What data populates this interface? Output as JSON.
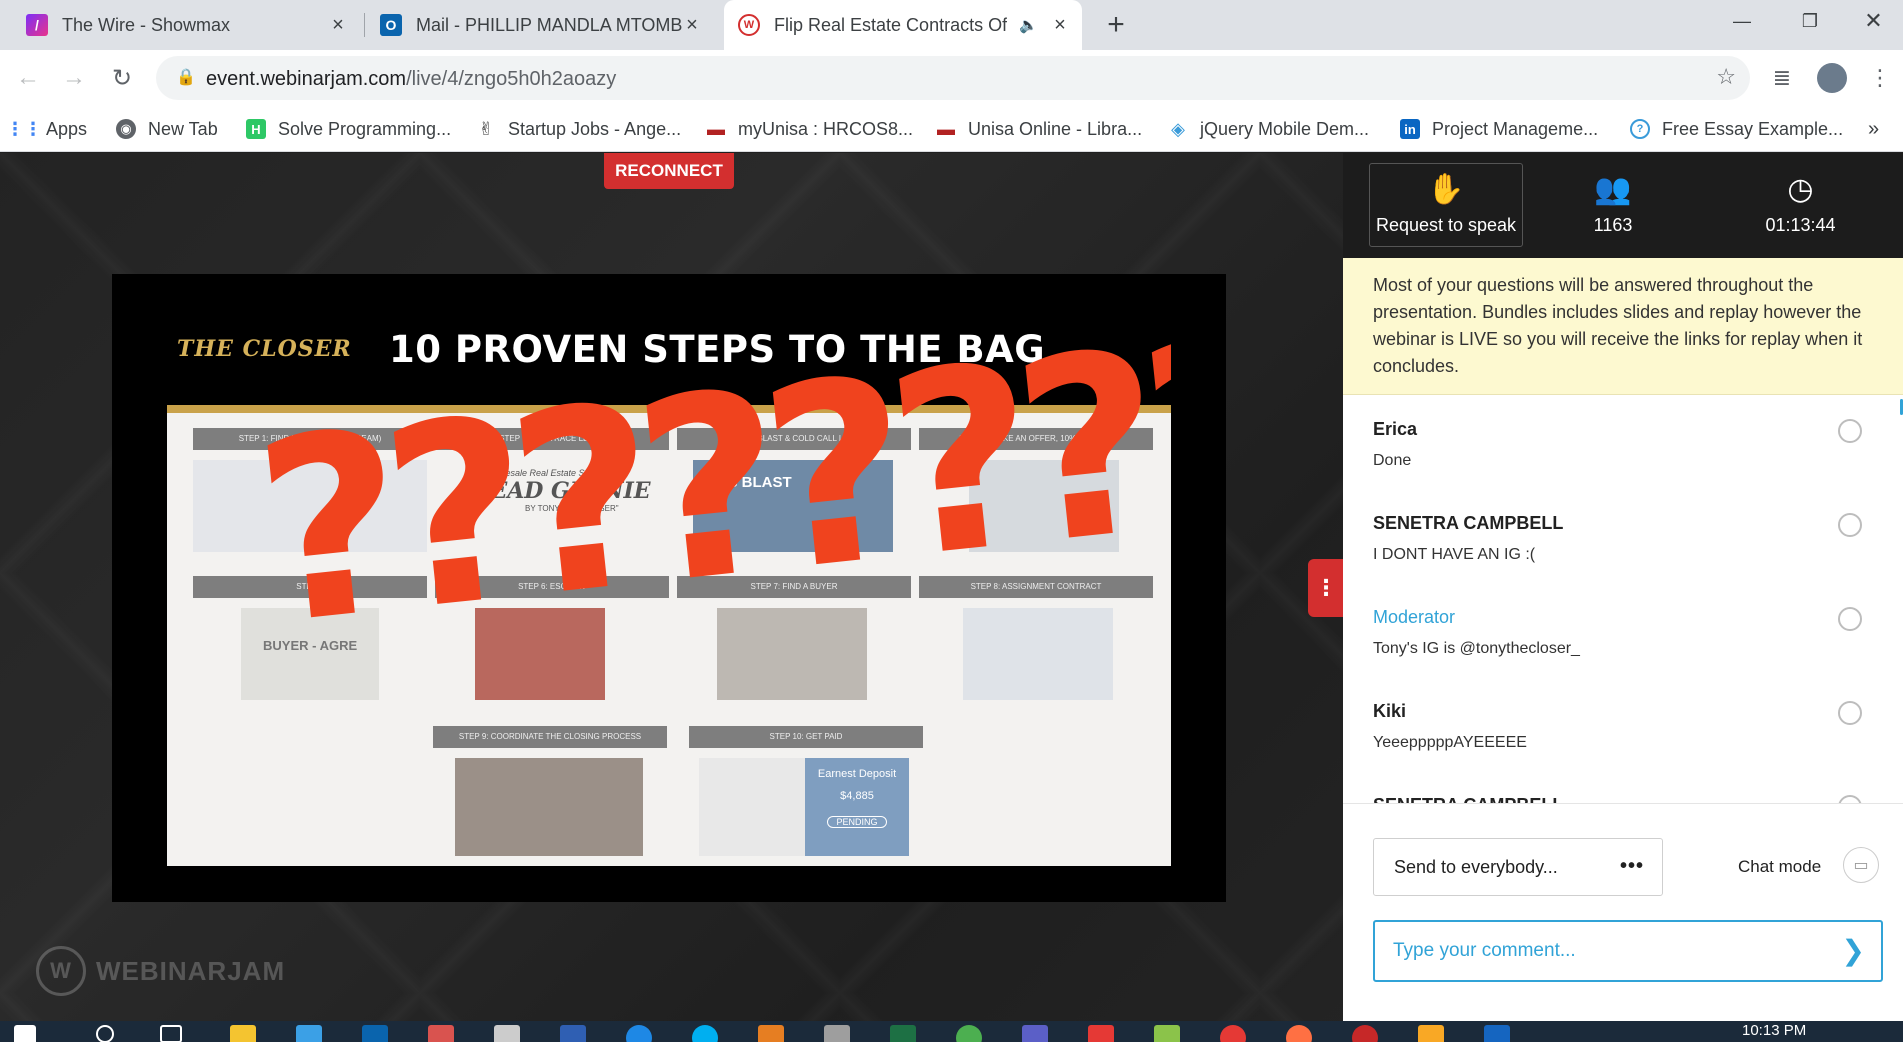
{
  "browser": {
    "tabs": [
      {
        "title": "The Wire - Showmax",
        "icon": "showmax-icon",
        "active": false
      },
      {
        "title": "Mail - PHILLIP MANDLA MTOMB",
        "icon": "outlook-icon",
        "active": false
      },
      {
        "title": "Flip Real Estate Contracts Of",
        "icon": "webinarjam-icon",
        "active": true
      }
    ],
    "new_tab": "+",
    "url_host": "event.webinarjam.com",
    "url_path": "/live/4/zngo5h0h2aoazy",
    "bookmarks": [
      {
        "label": "Apps",
        "icon": "apps-grid-icon",
        "color": "#4285f4"
      },
      {
        "label": "New Tab",
        "icon": "globe-icon",
        "color": "#5f6368"
      },
      {
        "label": "Solve Programming...",
        "icon": "hackerrank-icon",
        "color": "#2ec866"
      },
      {
        "label": "Startup Jobs - Ange...",
        "icon": "angellist-icon",
        "color": "#333333"
      },
      {
        "label": "myUnisa : HRCOS8...",
        "icon": "unisa-icon",
        "color": "#b22222"
      },
      {
        "label": "Unisa Online - Libra...",
        "icon": "unisa-icon",
        "color": "#b22222"
      },
      {
        "label": "jQuery Mobile Dem...",
        "icon": "jquery-icon",
        "color": "#3a9bd9"
      },
      {
        "label": "Project Manageme...",
        "icon": "linkedin-icon",
        "color": "#0a66c2"
      },
      {
        "label": "Free Essay Example...",
        "icon": "essay-icon",
        "color": "#3a9bd9"
      }
    ],
    "bookmarks_more": "»"
  },
  "stage": {
    "reconnect_label": "RECONNECT",
    "slide": {
      "logo": "THE CLOSER",
      "title": "10 PROVEN STEPS TO THE BAG",
      "question_marks": "????????",
      "steps": [
        "STEP 1: FIND LEADS (PROPSTREAM)",
        "STEP 2: SKIPTRACE LEADS",
        "STEP 3: (BLAST & COLD CALL LEADS",
        "STEP 4: MAKE AN OFFER, 10% PER DAY",
        "STEP 5",
        "STEP 6: ESCROW",
        "STEP 7: FIND A BUYER",
        "STEP 8: ASSIGNMENT CONTRACT",
        "STEP 9: COORDINATE THE CLOSING PROCESS",
        "STEP 10: GET PAID"
      ],
      "thumb_texts": {
        "lead_geenie_tag": "Wholesale Real Estate Services!",
        "lead_geenie": "LEAD GEENIE",
        "lead_geenie_by": "BY TONY \"THE CLOSER\"",
        "sms_blast": "SMS BLAST",
        "buyer_agreement": "BUYER - AGRE",
        "earnest_deposit": "Earnest Deposit",
        "deposit_amount": "$4,885",
        "pending": "PENDING"
      }
    },
    "watermark": "WEBINARJAM"
  },
  "sidebar": {
    "request_to_speak": "Request to speak",
    "attendee_count": "1163",
    "elapsed_time": "01:13:44",
    "notice": "Most of your questions will be answered throughout the presentation. Bundles includes slides and replay however the webinar is LIVE so you will receive the links for replay when it concludes.",
    "messages": [
      {
        "author": "Erica",
        "text": "Done",
        "moderator": false
      },
      {
        "author": "SENETRA CAMPBELL",
        "text": "I DONT HAVE AN IG :(",
        "moderator": false
      },
      {
        "author": "Moderator",
        "text": "Tony's IG is @tonythecloser_",
        "moderator": true
      },
      {
        "author": "Kiki",
        "text": "YeeepppppAYEEEEE",
        "moderator": false
      },
      {
        "author": "SENETRA CAMPBELL",
        "text": "",
        "moderator": false
      }
    ],
    "send_to": "Send to everybody...",
    "send_to_more": "•••",
    "chat_mode": "Chat mode",
    "comment_placeholder": "Type your comment..."
  },
  "taskbar": {
    "clock_time": "10:13 PM"
  },
  "colors": {
    "accent": "#31a3d7",
    "reconnect": "#d32f2f",
    "notice_bg": "#fdf9d0",
    "question_marks": "#f0431e"
  }
}
